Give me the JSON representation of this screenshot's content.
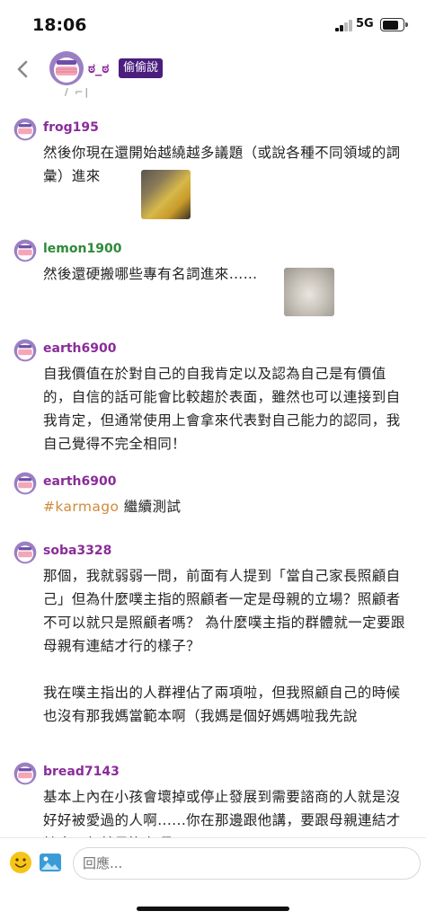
{
  "status_bar": {
    "time": "18:06",
    "network": "5G"
  },
  "header": {
    "name": "ಠ_ಠ",
    "badge": "偷偷說",
    "deco": "/ ⌐|"
  },
  "comments": [
    {
      "author": "frog195",
      "author_color": "#8a2c9a",
      "body": "然後你現在還開始越繞越多議題（或說各種不同領域的詞彙）進來",
      "image": "pikachu-meme"
    },
    {
      "author": "lemon1900",
      "author_color": "#2e8a3a",
      "body": "然後還硬搬哪些專有名詞進來……",
      "image": "seal-meme"
    },
    {
      "author": "earth6900",
      "author_color": "#8a2c9a",
      "body": "自我價值在於對自己的自我肯定以及認為自己是有價值的，自信的話可能會比較趨於表面，雖然也可以連接到自我肯定，但通常使用上會拿來代表對自己能力的認同，我自己覺得不完全相同！"
    },
    {
      "author": "earth6900",
      "author_color": "#8a2c9a",
      "tag": "#karmago",
      "body": " 繼續測試"
    },
    {
      "author": "soba3328",
      "author_color": "#8a2c9a",
      "body": "那個，我就弱弱一問，前面有人提到「當自己家長照顧自己」但為什麼噗主指的照顧者一定是母親的立場？照顧者不可以就只是照顧者嗎？ 為什麼噗主指的群體就一定要跟母親有連結才行的樣子？\n\n我在噗主指出的人群裡佔了兩項啦，但我照顧自己的時候也沒有那我媽當範本啊（我媽是個好媽媽啦我先說"
    },
    {
      "author": "bread7143",
      "author_color": "#8a2c9a",
      "body": "基本上內在小孩會壞掉或停止發展到需要諮商的人就是沒好好被愛過的人啊......你在那邊跟他講，要跟母親連結才健康，但就是沒有啊。"
    }
  ],
  "reply": {
    "placeholder": "回應..."
  },
  "icons": {
    "back": "back-chevron-icon",
    "emoji": "emoji-icon",
    "image": "image-upload-icon"
  },
  "colors": {
    "accent": "#8a2c9a",
    "badge": "#4b1e7e",
    "tag": "#d08a3a"
  }
}
